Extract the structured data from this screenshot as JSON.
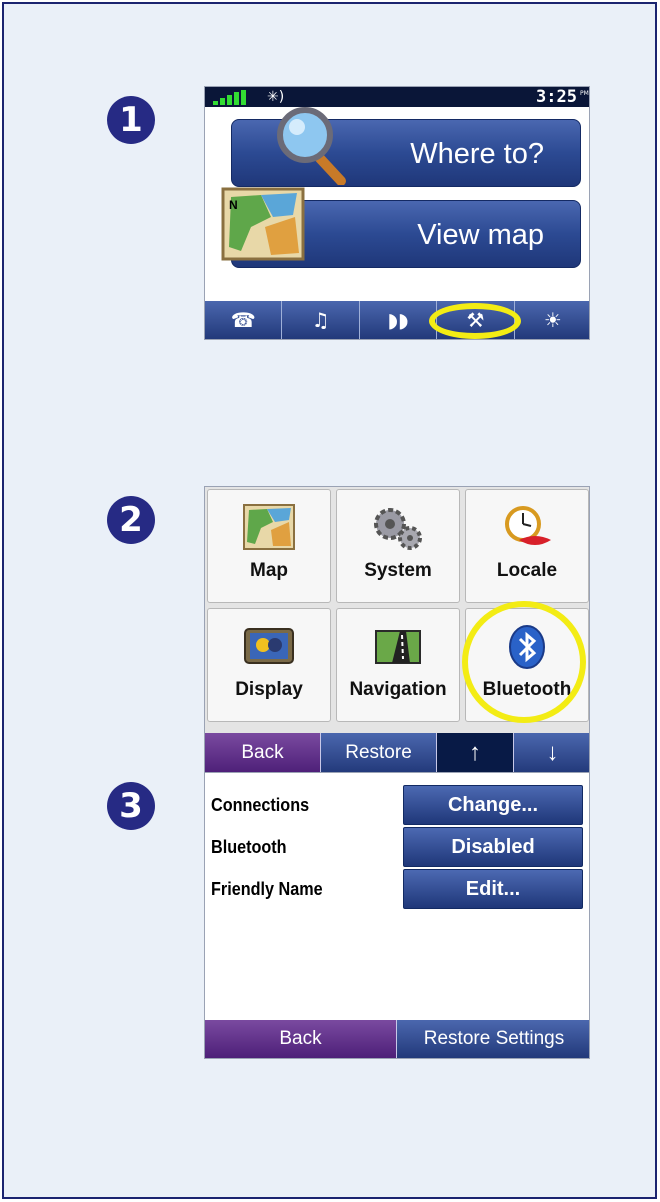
{
  "steps": [
    "1",
    "2",
    "3"
  ],
  "screen1": {
    "bluetooth_status": "✳)",
    "time": "3:25",
    "ampm": "PM",
    "where_to_label": "Where to?",
    "view_map_label": "View map",
    "toolbar": [
      {
        "name": "phone-icon",
        "glyph": "☎"
      },
      {
        "name": "music-icon",
        "glyph": "♫"
      },
      {
        "name": "traffic-icon",
        "glyph": "◗◗"
      },
      {
        "name": "wrench-icon",
        "glyph": "⚒"
      },
      {
        "name": "brightness-icon",
        "glyph": "☀"
      }
    ]
  },
  "screen2": {
    "tiles": [
      {
        "label": "Map",
        "icon": "map-icon"
      },
      {
        "label": "System",
        "icon": "gears-icon"
      },
      {
        "label": "Locale",
        "icon": "clock-icon"
      },
      {
        "label": "Display",
        "icon": "display-icon"
      },
      {
        "label": "Navigation",
        "icon": "road-icon"
      },
      {
        "label": "Bluetooth",
        "icon": "bluetooth-icon"
      }
    ],
    "back_label": "Back",
    "restore_label": "Restore",
    "up_glyph": "🡅",
    "down_glyph": "🡇"
  },
  "screen3": {
    "rows": [
      {
        "label": "Connections",
        "button": "Change..."
      },
      {
        "label": "Bluetooth",
        "button": "Disabled"
      },
      {
        "label": "Friendly Name",
        "button": "Edit..."
      }
    ],
    "back_label": "Back",
    "restore_settings_label": "Restore Settings"
  },
  "colors": {
    "page_bg": "#eaf0f8",
    "page_border": "#1b2470",
    "button_blue": "#2c4a93",
    "back_purple": "#5a2b86",
    "highlight_yellow": "#f3ec14"
  }
}
